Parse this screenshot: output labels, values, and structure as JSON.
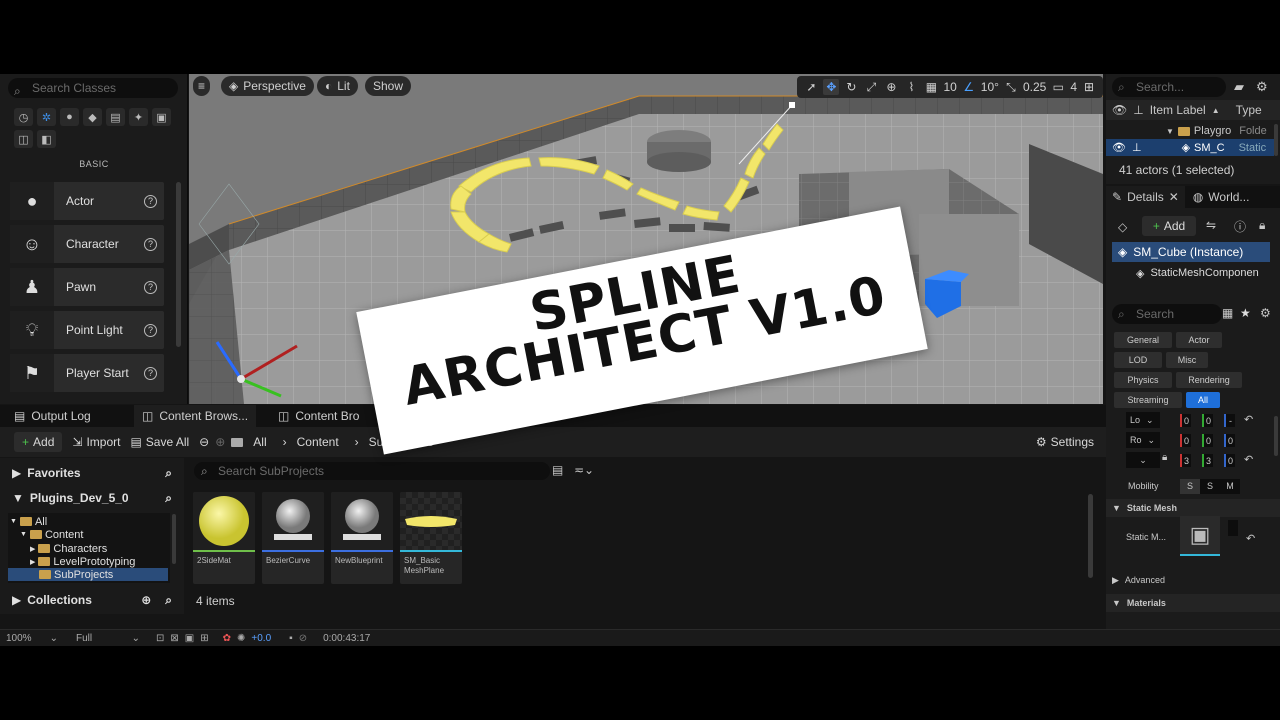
{
  "place_actors": {
    "search_placeholder": "Search Classes",
    "category_label": "BASIC",
    "items": [
      {
        "label": "Actor",
        "icon": "sphere-icon"
      },
      {
        "label": "Character",
        "icon": "character-icon"
      },
      {
        "label": "Pawn",
        "icon": "pawn-icon"
      },
      {
        "label": "Point Light",
        "icon": "light-bulb-icon"
      },
      {
        "label": "Player Start",
        "icon": "flag-icon"
      }
    ]
  },
  "viewport": {
    "perspective_label": "Perspective",
    "lit_label": "Lit",
    "show_label": "Show",
    "grid_snap": "10",
    "rotation_snap": "10°",
    "scale_snap": "0.25",
    "camera_speed": "4"
  },
  "outliner": {
    "search_placeholder": "Search...",
    "col_item_label": "Item Label",
    "col_type": "Type",
    "row1_label": "Playgro",
    "row1_type": "Folde",
    "row2_label": "SM_C",
    "row2_type": "Static",
    "actor_count": "41 actors (1 selected)"
  },
  "details": {
    "tab_details": "Details",
    "tab_world": "World...",
    "add_label": "Add",
    "instance_label": "SM_Cube (Instance)",
    "component_label": "StaticMeshComponen",
    "search_placeholder": "Search",
    "filters": [
      "General",
      "Actor",
      "LOD",
      "Misc",
      "Physics",
      "Rendering",
      "Streaming",
      "All"
    ],
    "loc_label": "Lo",
    "rot_label": "Ro",
    "loc_values": [
      "0",
      "0",
      "-"
    ],
    "rot_values": [
      "0",
      "0",
      "0"
    ],
    "scale_values": [
      "3",
      "3",
      "0"
    ],
    "mobility_label": "Mobility",
    "mobility_options": [
      "S",
      "S",
      "M"
    ],
    "section_static_mesh": "Static Mesh",
    "static_mesh_label": "Static M...",
    "section_advanced": "Advanced",
    "section_materials": "Materials"
  },
  "bottom_tabs": [
    "Output Log",
    "Content Brows...",
    "Content Bro"
  ],
  "content_browser": {
    "add_label": "Add",
    "import_label": "Import",
    "save_all_label": "Save All",
    "breadcrumb": [
      "All",
      "Content",
      "SubProjects"
    ],
    "settings_label": "Settings",
    "favorites_label": "Favorites",
    "project_label": "Plugins_Dev_5_0",
    "tree": [
      "All",
      "Content",
      "Characters",
      "LevelPrototyping",
      "SubProjects"
    ],
    "collections_label": "Collections",
    "search_placeholder": "Search SubProjects",
    "assets": [
      {
        "name": "2SideMat",
        "color": "#6fbf4a"
      },
      {
        "name": "BezierCurve",
        "color": "#3c6fe0"
      },
      {
        "name": "NewBlueprint",
        "color": "#3c6fe0"
      },
      {
        "name": "SM_Basic MeshPlane",
        "color": "#34b8d9"
      }
    ],
    "item_count": "4 items"
  },
  "status_bar": {
    "zoom": "100%",
    "view_mode": "Full",
    "offset": "+0.0",
    "time": "0:00:43:17"
  },
  "title_card": {
    "line1": "SPLINE",
    "line2": "ARCHITECT V1.0"
  },
  "colors": {
    "accent_blue": "#1e6fd9",
    "spline_yellow": "#f2e66a",
    "folder": "#c9a04c"
  }
}
